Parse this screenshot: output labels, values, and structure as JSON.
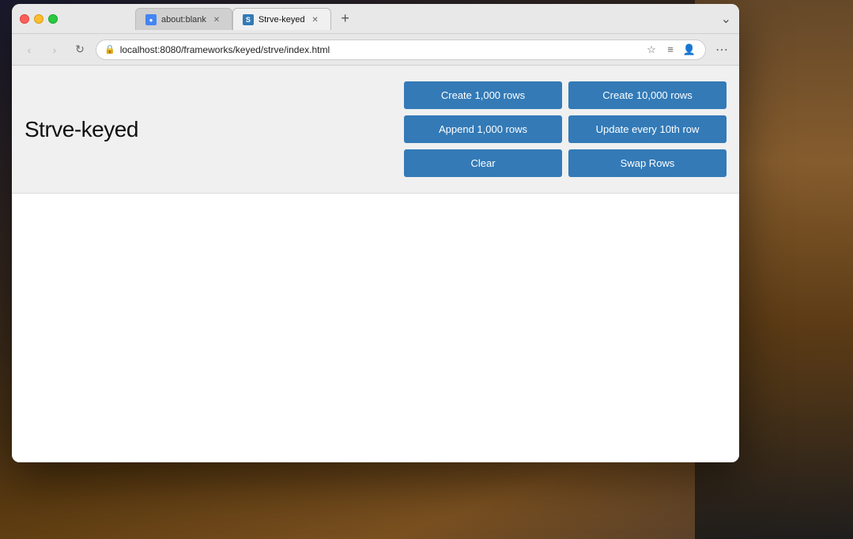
{
  "desktop": {
    "label": "macOS Desktop"
  },
  "browser": {
    "tabs": [
      {
        "id": "tab-blank",
        "favicon_char": "●",
        "title": "about:blank",
        "active": false,
        "closeable": true
      },
      {
        "id": "tab-strve",
        "favicon_char": "S",
        "title": "Strve-keyed",
        "active": true,
        "closeable": true
      }
    ],
    "new_tab_label": "+",
    "nav": {
      "back_label": "‹",
      "forward_label": "›",
      "refresh_label": "↻"
    },
    "address": {
      "lock_icon": "🔒",
      "url": "localhost:8080/frameworks/keyed/strve/index.html",
      "bookmark_icon": "☆",
      "reader_icon": "≡",
      "profile_icon": "👤",
      "more_icon": "⋯"
    }
  },
  "app": {
    "title": "Strve-keyed",
    "buttons": [
      {
        "id": "create-1000",
        "label": "Create 1,000 rows"
      },
      {
        "id": "create-10000",
        "label": "Create 10,000 rows"
      },
      {
        "id": "append-1000",
        "label": "Append 1,000 rows"
      },
      {
        "id": "update-every-10th",
        "label": "Update every 10th row"
      },
      {
        "id": "clear",
        "label": "Clear"
      },
      {
        "id": "swap-rows",
        "label": "Swap Rows"
      }
    ]
  }
}
